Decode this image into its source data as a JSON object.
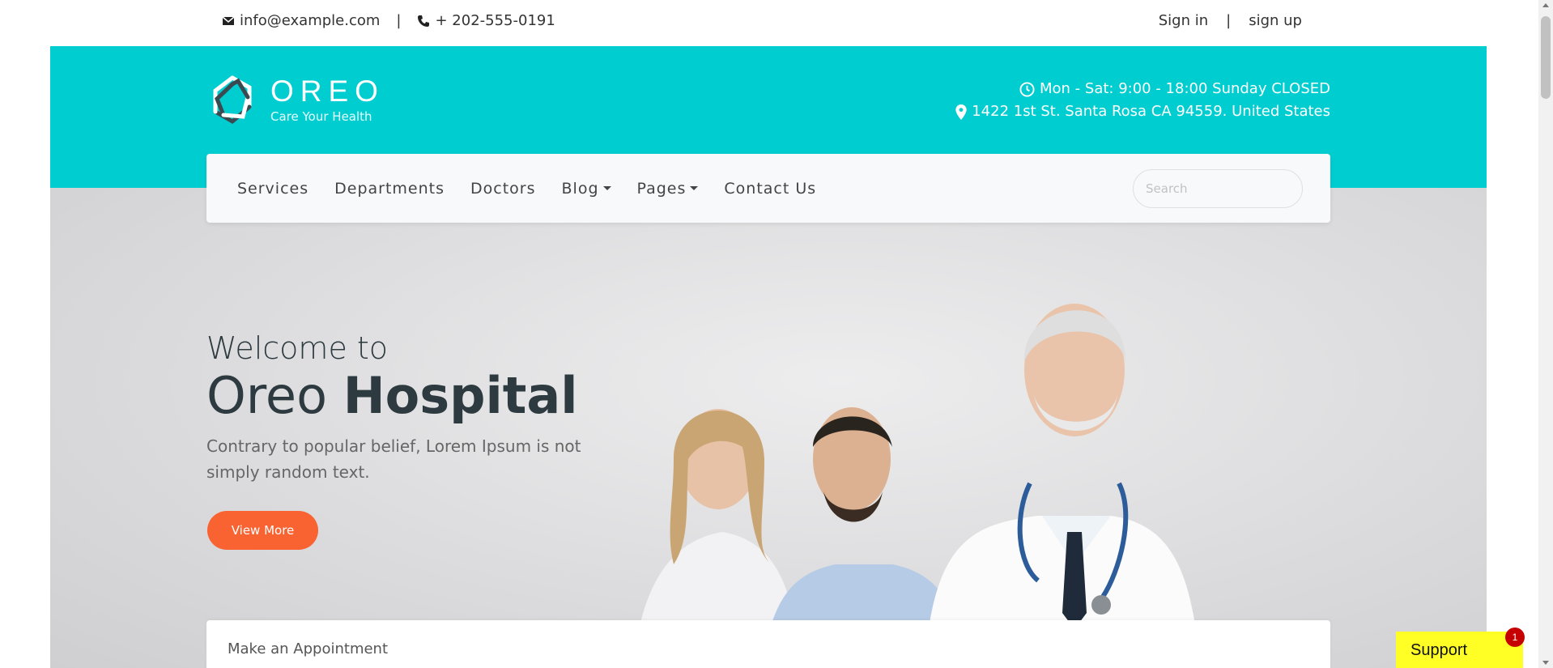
{
  "topbar": {
    "email": "info@example.com",
    "separator": "|",
    "phone": "+ 202-555-0191",
    "sign_in": "Sign in",
    "sign_up": "sign up"
  },
  "brand": {
    "name": "OREO",
    "tagline": "Care Your Health",
    "primary_color": "#00cdd0",
    "accent_color": "#f96332"
  },
  "info": {
    "hours": "Mon - Sat: 9:00 - 18:00 Sunday CLOSED",
    "address": "1422 1st St. Santa Rosa CA 94559. United States"
  },
  "nav": {
    "items": [
      "Services",
      "Departments",
      "Doctors",
      "Blog",
      "Pages",
      "Contact Us"
    ],
    "search_placeholder": "Search"
  },
  "hero": {
    "welcome": "Welcome to",
    "title_light": "Oreo",
    "title_bold": "Hospital",
    "lead": "Contrary to popular belief, Lorem Ipsum is not simply random text.",
    "button": "View More"
  },
  "appointment": {
    "title": "Make an Appointment"
  },
  "support": {
    "label": "Support",
    "badge": "1"
  },
  "icons": [
    "email-icon",
    "phone-icon",
    "clock-icon",
    "map-pin-icon",
    "logo-icon",
    "caret-down-icon"
  ]
}
